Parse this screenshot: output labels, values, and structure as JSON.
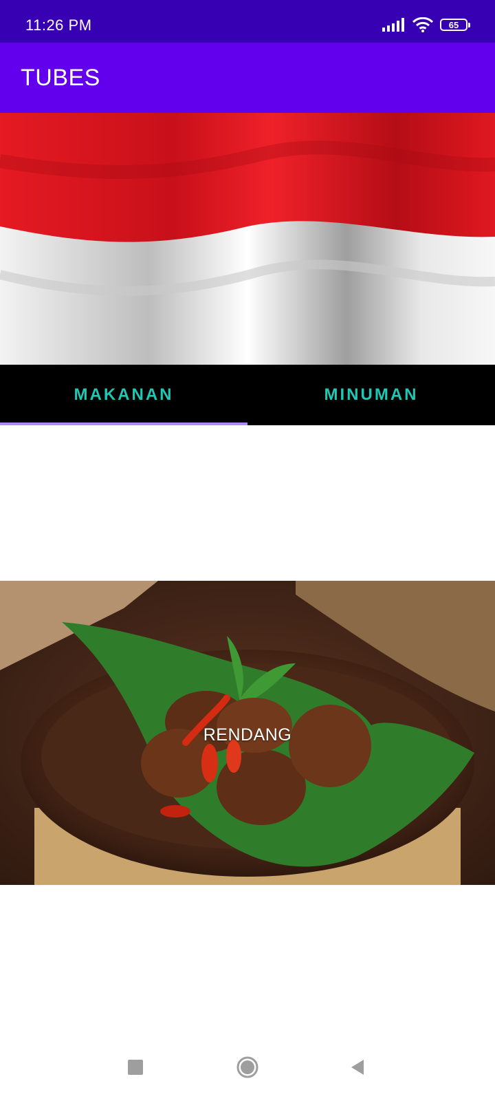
{
  "status_bar": {
    "time": "11:26 PM",
    "battery_level": "65",
    "icons": [
      "signal-icon",
      "wifi-icon",
      "battery-icon"
    ]
  },
  "app_bar": {
    "title": "TUBES"
  },
  "banner": {
    "image": "indonesia-flag",
    "colors": [
      "#e0161e",
      "#ffffff"
    ]
  },
  "tabs": [
    {
      "label": "MAKANAN",
      "selected": true
    },
    {
      "label": "MINUMAN",
      "selected": false
    }
  ],
  "food_item": {
    "label": "RENDANG",
    "image": "rendang-dish-photo"
  },
  "nav_bar": {
    "buttons": [
      "recents-icon",
      "home-icon",
      "back-icon"
    ]
  },
  "colors": {
    "status_bar": "#3700b3",
    "app_bar": "#6200ee",
    "tab_text": "#1ec8b4",
    "tab_indicator": "#b388ff"
  }
}
